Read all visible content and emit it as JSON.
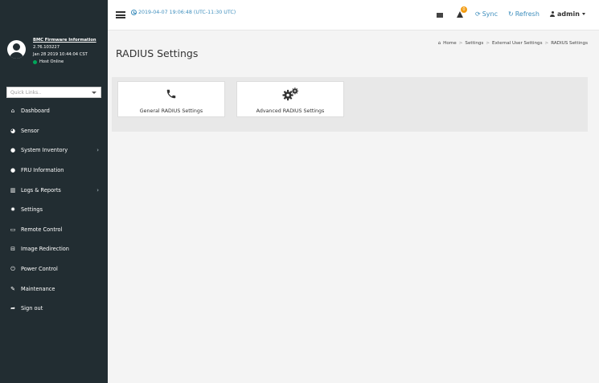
{
  "topbar": {
    "datetime": "2019-04-07 19:06:48 (UTC-11:30 UTC)",
    "alert_count": "0",
    "sync_label": "Sync",
    "refresh_label": "Refresh",
    "user_label": "admin"
  },
  "sidebar": {
    "fw_link": "BMC Firmware Information",
    "fw_version": "2.76.103227",
    "fw_date": "Jan 28 2019 10:44:04 CST",
    "host_status": "Host Online",
    "quicklinks_placeholder": "Quick Links..",
    "items": [
      {
        "label": "Dashboard",
        "icon": "dashboard-icon"
      },
      {
        "label": "Sensor",
        "icon": "sensor-icon"
      },
      {
        "label": "System Inventory",
        "icon": "info-icon",
        "has_submenu": true
      },
      {
        "label": "FRU Information",
        "icon": "info-icon"
      },
      {
        "label": "Logs & Reports",
        "icon": "chart-icon",
        "has_submenu": true
      },
      {
        "label": "Settings",
        "icon": "gear-icon"
      },
      {
        "label": "Remote Control",
        "icon": "monitor-icon"
      },
      {
        "label": "Image Redirection",
        "icon": "disk-icon"
      },
      {
        "label": "Power Control",
        "icon": "power-icon"
      },
      {
        "label": "Maintenance",
        "icon": "wrench-icon"
      },
      {
        "label": "Sign out",
        "icon": "signout-icon"
      }
    ]
  },
  "main": {
    "title": "RADIUS Settings",
    "breadcrumb": [
      "Home",
      "Settings",
      "External User Settings",
      "RADIUS Settings"
    ],
    "cards": [
      {
        "label": "General RADIUS Settings",
        "icon": "phone-icon"
      },
      {
        "label": "Advanced RADIUS Settings",
        "icon": "gears-icon"
      }
    ]
  },
  "colors": {
    "sidebar_bg": "#222d32",
    "accent": "#3c8dbc",
    "online": "#00a65a",
    "badge": "#f39c12"
  }
}
